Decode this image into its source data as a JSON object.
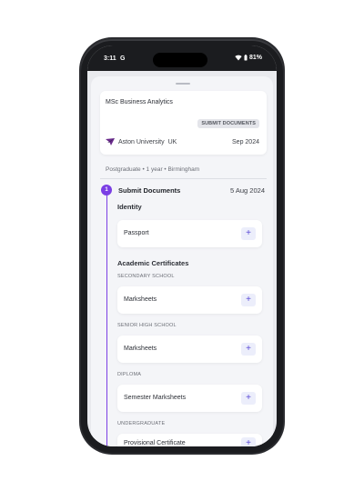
{
  "status_bar": {
    "time": "3:11",
    "app_glyph": "G",
    "battery": "81%"
  },
  "course": {
    "title": "MSc Business Analytics",
    "badge": "SUBMIT DOCUMENTS",
    "university": "Aston University",
    "country": "UK",
    "intake": "Sep 2024",
    "meta": "Postgraduate • 1 year • Birmingham"
  },
  "step": {
    "number": "1",
    "title": "Submit Documents",
    "date": "5 Aug 2024"
  },
  "identity": {
    "title": "Identity",
    "doc": "Passport"
  },
  "academic": {
    "title": "Academic Certificates",
    "groups": [
      {
        "label": "SECONDARY SCHOOL",
        "doc": "Marksheets"
      },
      {
        "label": "SENIOR HIGH SCHOOL",
        "doc": "Marksheets"
      },
      {
        "label": "DIPLOMA",
        "doc": "Semester Marksheets"
      },
      {
        "label": "UNDERGRADUATE",
        "doc": "Provisional Certificate"
      }
    ]
  },
  "add_label": "+",
  "colors": {
    "accent": "#7b3fe4",
    "add_button_bg": "#eceefb",
    "sheet_bg": "#f4f5f8"
  }
}
